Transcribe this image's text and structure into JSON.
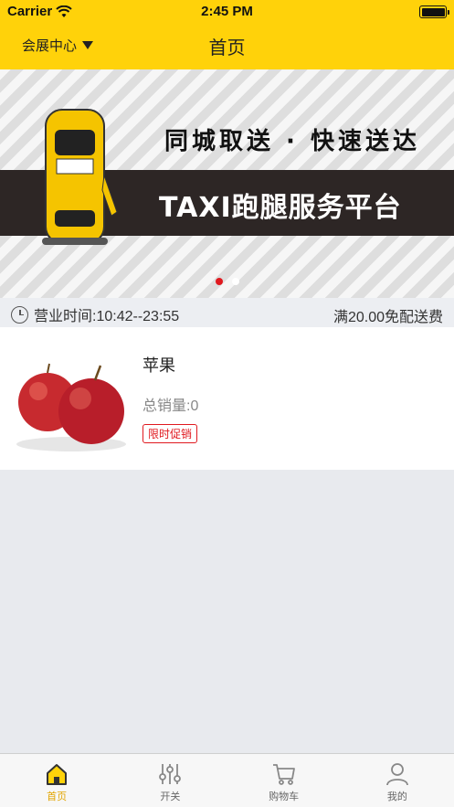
{
  "status_bar": {
    "carrier": "Carrier",
    "time": "2:45 PM"
  },
  "nav": {
    "location": "会展中心",
    "title": "首页"
  },
  "banner": {
    "slogan": "同城取送 · 快速送达",
    "platform": "TAXI跑腿服务平台",
    "active_slide": 0,
    "slide_count": 2
  },
  "info": {
    "hours": "营业时间:10:42--23:55",
    "delivery": "满20.00免配送费"
  },
  "products": [
    {
      "name": "苹果",
      "sales": "总销量:0",
      "tag": "限时促销"
    }
  ],
  "tabs": [
    {
      "label": "首页",
      "icon": "home-icon",
      "active": true
    },
    {
      "label": "开关",
      "icon": "sliders-icon",
      "active": false
    },
    {
      "label": "购物车",
      "icon": "cart-icon",
      "active": false
    },
    {
      "label": "我的",
      "icon": "user-icon",
      "active": false
    }
  ],
  "colors": {
    "brand": "#ffd20a",
    "accent": "#e0191f",
    "active_tab": "#e2a500"
  }
}
